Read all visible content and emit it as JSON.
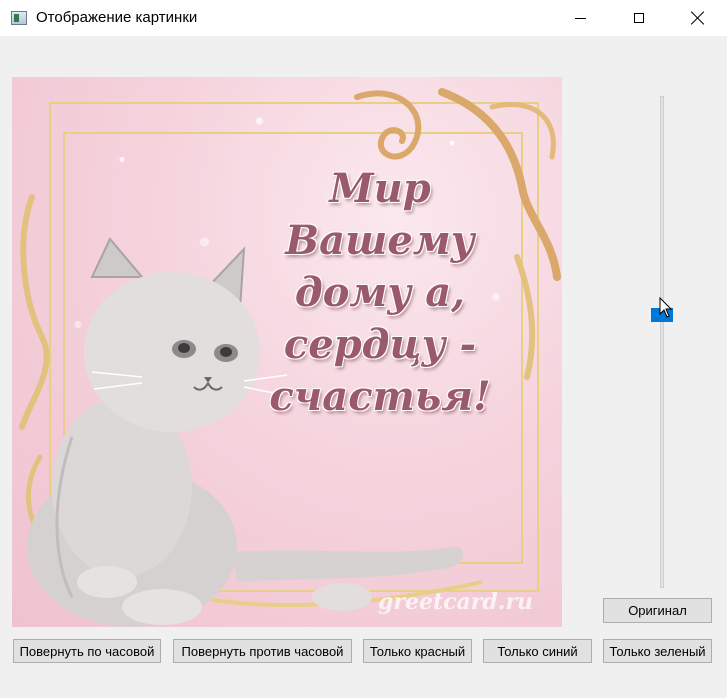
{
  "window": {
    "title": "Отображение картинки"
  },
  "image": {
    "greeting_lines": [
      "Мир",
      "Вашему",
      "дому а,",
      "сердцу -",
      "счастья!"
    ],
    "watermark": "greetcard.ru"
  },
  "slider": {
    "orientation": "vertical"
  },
  "buttons": {
    "original": "Оригинал",
    "rotate_cw": "Повернуть по часовой",
    "rotate_ccw": "Повернуть против часовой",
    "only_red": "Только красный",
    "only_blue": "Только синий",
    "only_green": "Только зеленый"
  },
  "colors": {
    "slider_handle": "#0078d7",
    "button_bg": "#e1e1e1",
    "window_bg": "#f0f0f0"
  }
}
